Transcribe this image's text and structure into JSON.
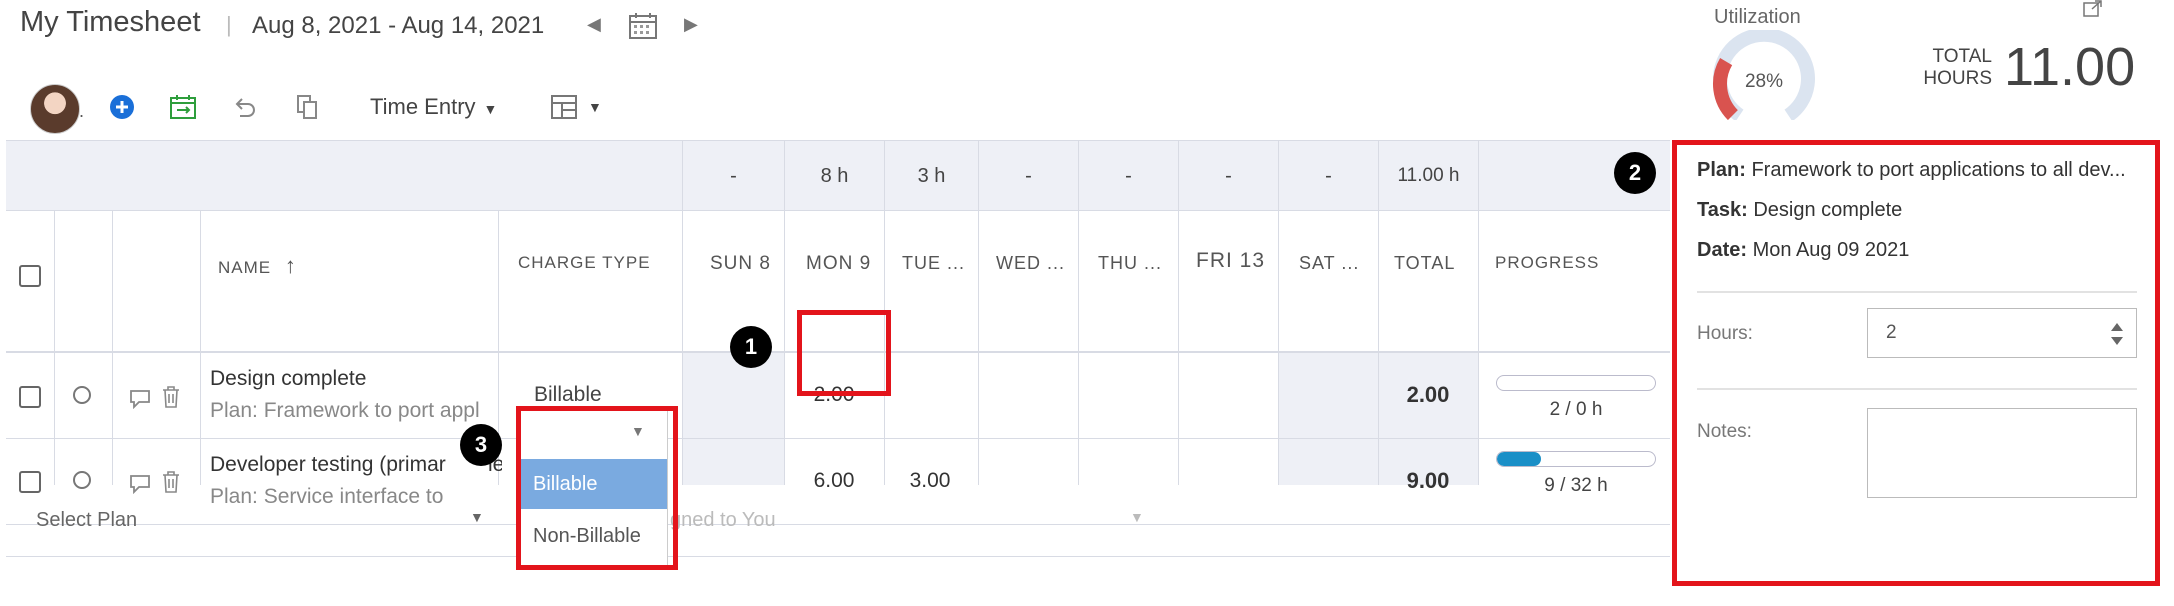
{
  "header": {
    "title": "My Timesheet",
    "separator": "|",
    "date_range": "Aug 8, 2021 - Aug 14, 2021",
    "prev_label": "◀",
    "next_label": "▶"
  },
  "toolbar": {
    "avatar_dot": ".",
    "view_label": "Time Entry",
    "view_caret": "▼"
  },
  "utilization": {
    "label": "Utilization",
    "value": "28%",
    "fraction": 0.28
  },
  "total_hours": {
    "label": "TOTAL\nHOURS",
    "value": "11.00"
  },
  "grid": {
    "totals_row": [
      "-",
      "8 h",
      "3 h",
      "-",
      "-",
      "-",
      "-",
      "11.00 h"
    ],
    "columns": {
      "name": "NAME",
      "sort_icon": "↑",
      "charge_type": "CHARGE TYPE",
      "days": [
        "SUN 8",
        "MON 9",
        "TUE ...",
        "WED ...",
        "THU ...",
        "FRI 13",
        "SAT ..."
      ],
      "total": "TOTAL",
      "progress": "PROGRESS"
    },
    "rows": [
      {
        "name": "Design complete",
        "plan": "Plan: Framework to port appl",
        "charge_type": "Billable",
        "values": [
          "",
          "2.00",
          "",
          "",
          "",
          "",
          ""
        ],
        "total": "2.00",
        "progress_fraction": 0,
        "progress_text": "2 / 0 h"
      },
      {
        "name": "Developer testing (primar",
        "name_tail": "le",
        "plan": "Plan: Service interface to",
        "charge_type": "",
        "values": [
          "",
          "6.00",
          "3.00",
          "",
          "",
          "",
          ""
        ],
        "total": "9.00",
        "progress_fraction": 0.28,
        "progress_text": "9 / 32 h"
      }
    ],
    "add_row": {
      "select_plan": "Select Plan",
      "assigned_placeholder": "gned to You",
      "caret": "▼"
    }
  },
  "charge_dropdown": {
    "caret": "▼",
    "options": [
      "Billable",
      "Non-Billable"
    ],
    "selected": "Billable"
  },
  "detail_panel": {
    "plan_label": "Plan:",
    "plan_value": "Framework to port applications to all dev...",
    "task_label": "Task:",
    "task_value": "Design complete",
    "date_label": "Date:",
    "date_value": "Mon Aug 09 2021",
    "hours_label": "Hours:",
    "hours_value": "2",
    "notes_label": "Notes:"
  },
  "annotations": {
    "badges": [
      "1",
      "2",
      "3"
    ],
    "highlight_color": "#e3141b"
  },
  "colors": {
    "progress_fill": "#1a8fc7",
    "gauge_fill": "#d9534f",
    "dropdown_selected": "#7aaae0",
    "header_band": "#eef0f6"
  },
  "icons": [
    "calendar-icon",
    "add-icon",
    "schedule-icon",
    "undo-icon",
    "copy-icon",
    "layout-icon",
    "expand-icon",
    "comment-icon",
    "trash-icon",
    "checkbox-icon",
    "status-circle-icon"
  ]
}
